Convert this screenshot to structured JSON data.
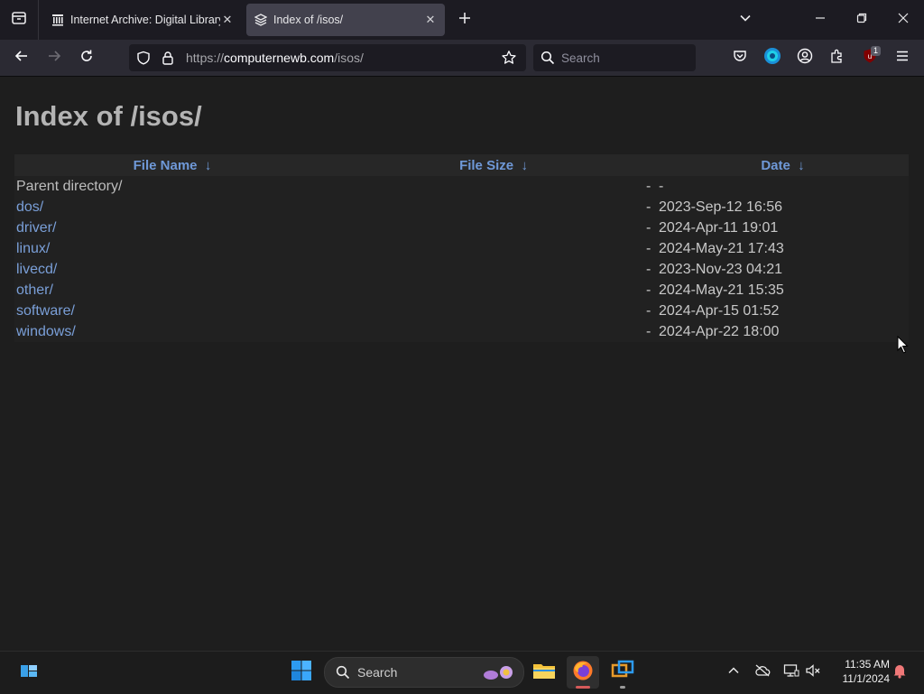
{
  "browser": {
    "tabs": [
      {
        "title": "Internet Archive: Digital Library",
        "active": false
      },
      {
        "title": "Index of /isos/",
        "active": true
      }
    ],
    "url": {
      "domain": "computernewb.com",
      "prefix": "https://",
      "path": "/isos/"
    },
    "search_placeholder": "Search",
    "extension_badge": "1"
  },
  "page": {
    "title": "Index of /isos/",
    "columns": [
      {
        "label": "File Name",
        "sort": "↓"
      },
      {
        "label": "File Size",
        "sort": "↓"
      },
      {
        "label": "Date",
        "sort": "↓"
      }
    ],
    "rows": [
      {
        "name": "Parent directory/",
        "size": "-",
        "date": "-",
        "link": false
      },
      {
        "name": "dos/",
        "size": "-",
        "date": "2023-Sep-12 16:56",
        "link": true
      },
      {
        "name": "driver/",
        "size": "-",
        "date": "2024-Apr-11 19:01",
        "link": true
      },
      {
        "name": "linux/",
        "size": "-",
        "date": "2024-May-21 17:43",
        "link": true
      },
      {
        "name": "livecd/",
        "size": "-",
        "date": "2023-Nov-23 04:21",
        "link": true
      },
      {
        "name": "other/",
        "size": "-",
        "date": "2024-May-21 15:35",
        "link": true
      },
      {
        "name": "software/",
        "size": "-",
        "date": "2024-Apr-15 01:52",
        "link": true
      },
      {
        "name": "windows/",
        "size": "-",
        "date": "2024-Apr-22 18:00",
        "link": true
      }
    ]
  },
  "taskbar": {
    "search_label": "Search",
    "time": "11:35 AM",
    "date": "11/1/2024"
  },
  "colors": {
    "link": "#7a9fd8",
    "header_link": "#6f99d8",
    "page_bg": "#1e1e1e",
    "tab_active": "#42414d",
    "toolbar": "#2b2a33"
  }
}
